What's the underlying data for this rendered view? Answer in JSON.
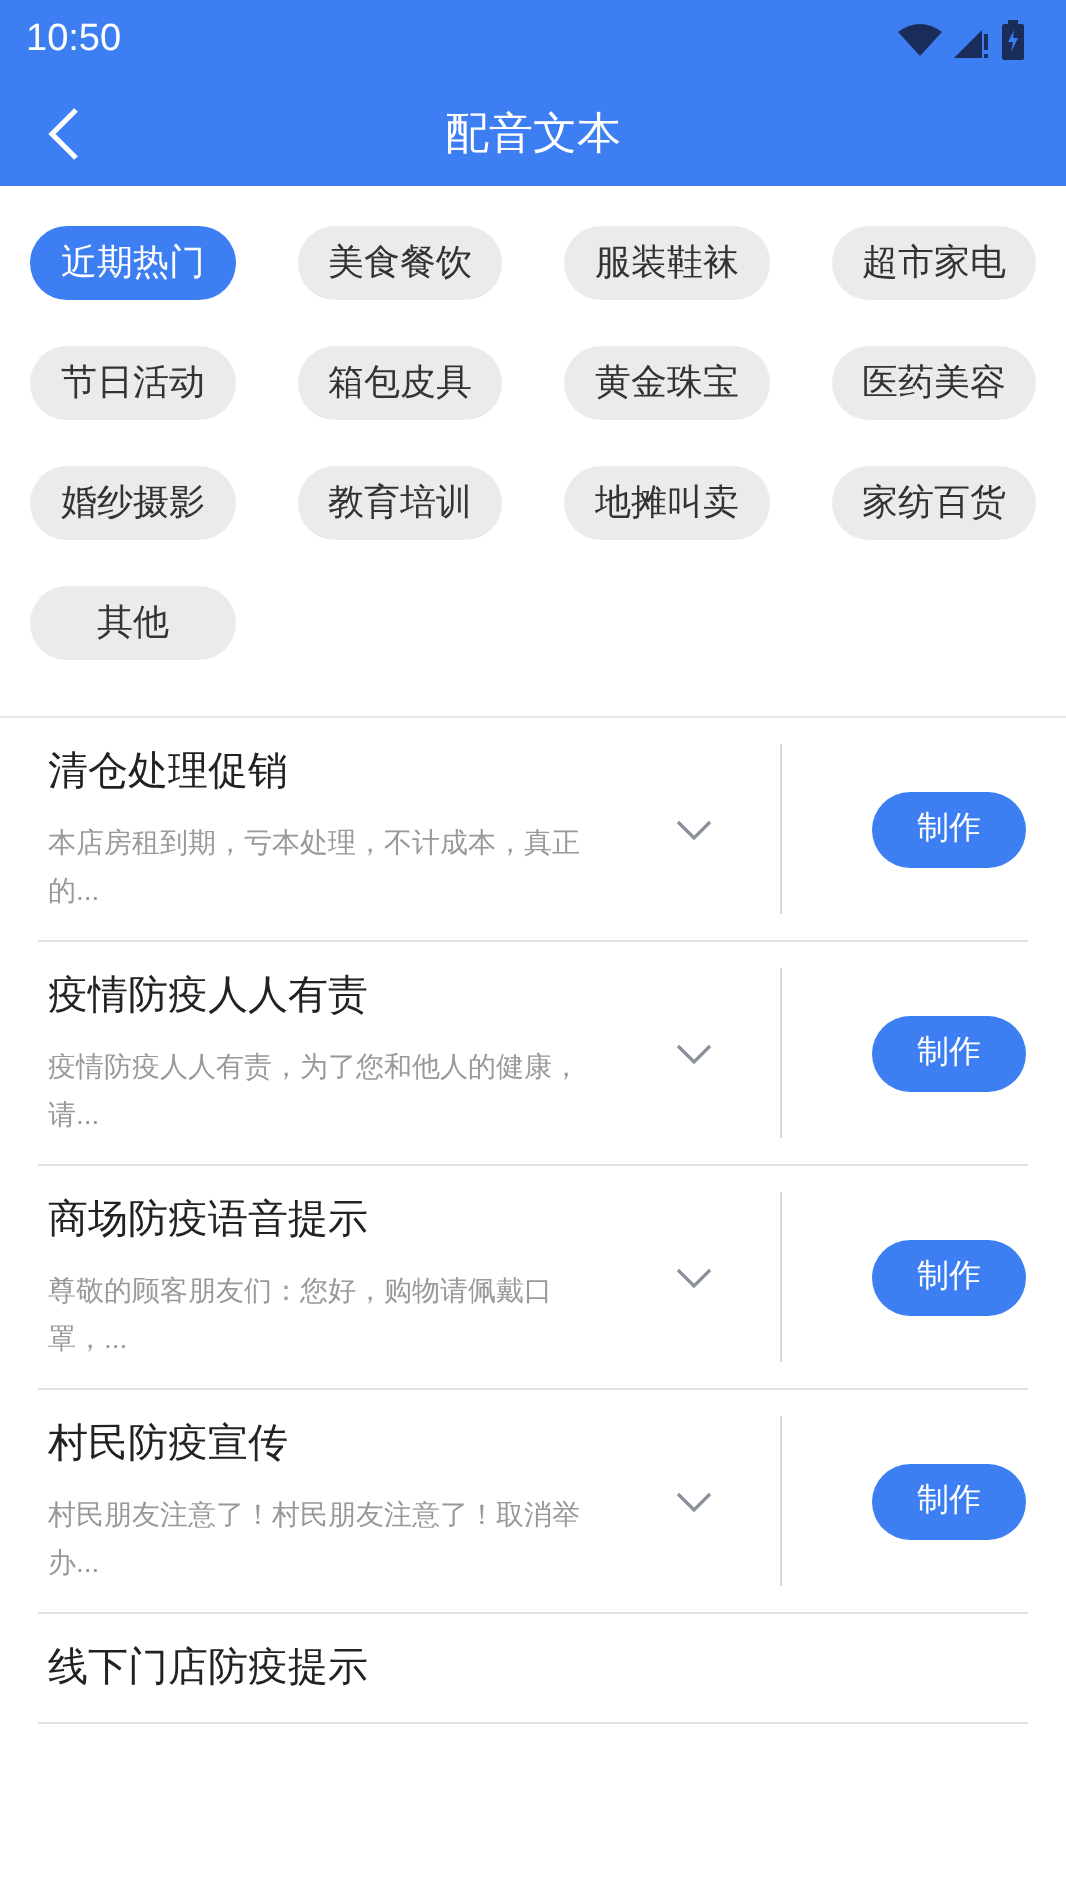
{
  "status_bar": {
    "time": "10:50"
  },
  "header": {
    "title": "配音文本"
  },
  "categories": [
    {
      "label": "近期热门",
      "selected": true
    },
    {
      "label": "美食餐饮",
      "selected": false
    },
    {
      "label": "服装鞋袜",
      "selected": false
    },
    {
      "label": "超市家电",
      "selected": false
    },
    {
      "label": "节日活动",
      "selected": false
    },
    {
      "label": "箱包皮具",
      "selected": false
    },
    {
      "label": "黄金珠宝",
      "selected": false
    },
    {
      "label": "医药美容",
      "selected": false
    },
    {
      "label": "婚纱摄影",
      "selected": false
    },
    {
      "label": "教育培训",
      "selected": false
    },
    {
      "label": "地摊叫卖",
      "selected": false
    },
    {
      "label": "家纺百货",
      "selected": false
    },
    {
      "label": "其他",
      "selected": false
    }
  ],
  "scripts": [
    {
      "title": "清仓处理促销",
      "description": "本店房租到期，亏本处理，不计成本，真正的...",
      "button": "制作"
    },
    {
      "title": "疫情防疫人人有责",
      "description": "疫情防疫人人有责，为了您和他人的健康，请...",
      "button": "制作"
    },
    {
      "title": "商场防疫语音提示",
      "description": "尊敬的顾客朋友们：您好，购物请佩戴口罩，...",
      "button": "制作"
    },
    {
      "title": "村民防疫宣传",
      "description": "村民朋友注意了！村民朋友注意了！取消举办...",
      "button": "制作"
    },
    {
      "title": "线下门店防疫提示"
    }
  ]
}
